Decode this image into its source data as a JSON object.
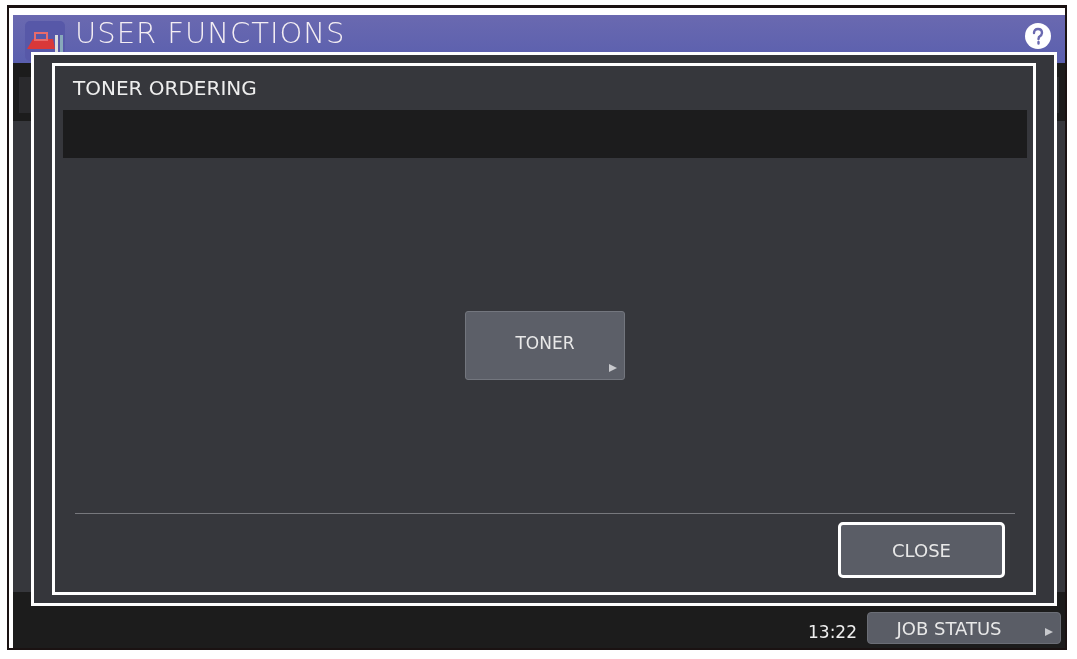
{
  "header": {
    "title": "USER FUNCTIONS"
  },
  "status_bar": {
    "time": "13:22",
    "job_status": "JOB STATUS"
  },
  "dialog": {
    "title": "TONER ORDERING",
    "buttons": [
      {
        "label": "TONER",
        "kind": "submenu"
      }
    ],
    "close": "CLOSE"
  }
}
